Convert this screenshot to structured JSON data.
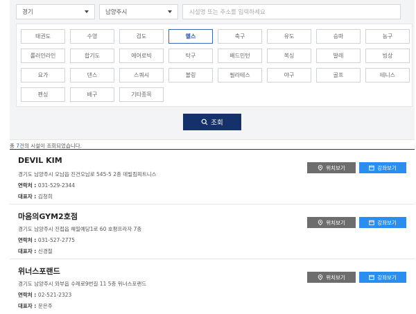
{
  "filters": {
    "region": "경기",
    "city": "남양주시",
    "search_placeholder": "시설명 또는 주소를 입력하세요"
  },
  "categories": [
    {
      "label": "태권도",
      "active": false
    },
    {
      "label": "수영",
      "active": false
    },
    {
      "label": "검도",
      "active": false
    },
    {
      "label": "헬스",
      "active": true
    },
    {
      "label": "축구",
      "active": false
    },
    {
      "label": "유도",
      "active": false
    },
    {
      "label": "승마",
      "active": false
    },
    {
      "label": "농구",
      "active": false
    },
    {
      "label": "롤러인라인",
      "active": false
    },
    {
      "label": "합기도",
      "active": false
    },
    {
      "label": "에어로빅",
      "active": false
    },
    {
      "label": "탁구",
      "active": false
    },
    {
      "label": "배드민턴",
      "active": false
    },
    {
      "label": "복싱",
      "active": false
    },
    {
      "label": "발레",
      "active": false
    },
    {
      "label": "빙상",
      "active": false
    },
    {
      "label": "요가",
      "active": false
    },
    {
      "label": "댄스",
      "active": false
    },
    {
      "label": "스쿼시",
      "active": false
    },
    {
      "label": "볼링",
      "active": false
    },
    {
      "label": "필라테스",
      "active": false
    },
    {
      "label": "야구",
      "active": false
    },
    {
      "label": "골프",
      "active": false
    },
    {
      "label": "테니스",
      "active": false
    },
    {
      "label": "펜싱",
      "active": false
    },
    {
      "label": "배구",
      "active": false
    },
    {
      "label": "기타종목",
      "active": false
    }
  ],
  "search_button": "조회",
  "result_summary": {
    "prefix": "총 ",
    "count": "7",
    "suffix": "건의 시설이 조회되었습니다."
  },
  "labels": {
    "contact": "연락처 : ",
    "representative": "대표자 : ",
    "location_button": "위치보기",
    "course_button": "강좌보기"
  },
  "results": [
    {
      "name": "DEVIL KIM",
      "address": "경기도 남양주시 오남읍 진건오남로 545-5 2층 데빌킴피트니스",
      "contact": "031-529-2344",
      "representative": "김청희"
    },
    {
      "name": "마음의GYM2호점",
      "address": "경기도 남양주시 진접읍 해밀예당1로 60 호평프라자 7층",
      "contact": "031-527-2775",
      "representative": "신경철"
    },
    {
      "name": "위너스포랜드",
      "address": "경기도 남양주시 와부읍 수레로9번길 11 5층 위너스포랜드",
      "contact": "02-521-2323",
      "representative": "문은주"
    }
  ],
  "colors": {
    "primary_button": "#15316b",
    "course_button": "#2a8df0",
    "location_button": "#6d6d6d",
    "active_category": "#3a62b5"
  }
}
